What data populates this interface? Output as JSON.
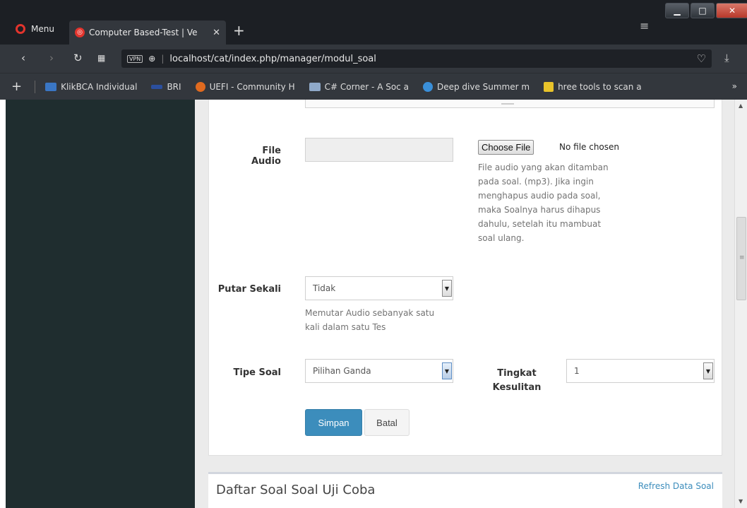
{
  "browser": {
    "menu_label": "Menu",
    "tab_title": "Computer Based-Test | Ve",
    "tab_close": "✕",
    "new_tab": "+",
    "url": "localhost/cat/index.php/manager/modul_soal",
    "vpn_badge": "VPN",
    "bookmarks": [
      {
        "label": "KlikBCA Individual",
        "color": "#3a76c4"
      },
      {
        "label": "BRI",
        "color": "#2b4f9e"
      },
      {
        "label": "UEFI - Community H",
        "color": "#e06a1f"
      },
      {
        "label": "C# Corner - A Soc a",
        "color": "#8fa9c9"
      },
      {
        "label": "Deep dive Summer m",
        "color": "#3a8fd9"
      },
      {
        "label": "hree tools to scan a",
        "color": "#e8c32a"
      }
    ],
    "bookmarks_more": "»"
  },
  "form": {
    "file_audio_label": "File Audio",
    "choose_file_label": "Choose File",
    "no_file_label": "No file chosen",
    "file_audio_help": [
      "File audio yang akan ditamban",
      "pada soal. (mp3). Jika ingin",
      "menghapus audio pada soal,",
      "maka Soalnya harus dihapus",
      "dahulu, setelah itu mambuat",
      "soal ulang."
    ],
    "putar_sekali_label": "Putar Sekali",
    "putar_sekali_value": "Tidak",
    "putar_sekali_help": [
      "Memutar Audio sebanyak satu",
      "kali dalam satu Tes"
    ],
    "tipe_soal_label": "Tipe Soal",
    "tipe_soal_value": "Pilihan Ganda",
    "tingkat_label_1": "Tingkat",
    "tingkat_label_2": "Kesulitan",
    "tingkat_value": "1",
    "save_label": "Simpan",
    "cancel_label": "Batal"
  },
  "list_panel": {
    "title": "Daftar Soal Soal Uji Coba",
    "refresh_label": "Refresh Data Soal"
  }
}
